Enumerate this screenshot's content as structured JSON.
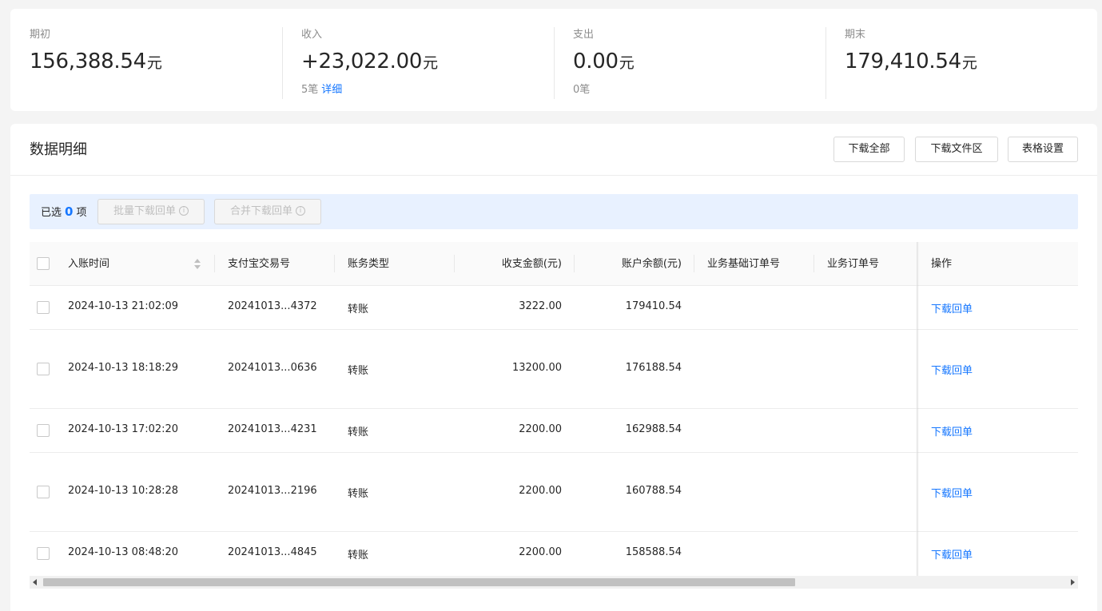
{
  "summary": {
    "opening": {
      "label": "期初",
      "value": "156,388.54",
      "unit": "元"
    },
    "income": {
      "label": "收入",
      "value": "+23,022.00",
      "unit": "元",
      "count": "5笔",
      "detail_link": "详细"
    },
    "expense": {
      "label": "支出",
      "value": "0.00",
      "unit": "元",
      "count": "0笔"
    },
    "closing": {
      "label": "期末",
      "value": "179,410.54",
      "unit": "元"
    }
  },
  "panel": {
    "title": "数据明细",
    "buttons": {
      "download_all": "下载全部",
      "download_files": "下载文件区",
      "table_settings": "表格设置"
    }
  },
  "selection": {
    "prefix": "已选",
    "count": "0",
    "suffix": "项",
    "batch_download": "批量下载回单",
    "merge_download": "合并下载回单",
    "info_glyph": "i"
  },
  "table": {
    "columns": {
      "time": "入账时间",
      "trade_no": "支付宝交易号",
      "type": "账务类型",
      "amount": "收支金额(元)",
      "balance": "账户余额(元)",
      "base_order": "业务基础订单号",
      "order": "业务订单号",
      "action": "操作"
    },
    "rows": [
      {
        "time": "2024-10-13 21:02:09",
        "trade_no": "20241013...4372",
        "type": "转账",
        "amount": "3222.00",
        "balance": "179410.54",
        "action": "下载回单"
      },
      {
        "time": "2024-10-13 18:18:29",
        "trade_no": "20241013...0636",
        "type": "转账",
        "amount": "13200.00",
        "balance": "176188.54",
        "action": "下载回单"
      },
      {
        "time": "2024-10-13 17:02:20",
        "trade_no": "20241013...4231",
        "type": "转账",
        "amount": "2200.00",
        "balance": "162988.54",
        "action": "下载回单"
      },
      {
        "time": "2024-10-13 10:28:28",
        "trade_no": "20241013...2196",
        "type": "转账",
        "amount": "2200.00",
        "balance": "160788.54",
        "action": "下载回单"
      },
      {
        "time": "2024-10-13 08:48:20",
        "trade_no": "20241013...4845",
        "type": "转账",
        "amount": "2200.00",
        "balance": "158588.54",
        "action": "下载回单"
      }
    ]
  },
  "colors": {
    "accent": "#1677ff",
    "selection_bg": "#e8f1ff"
  }
}
